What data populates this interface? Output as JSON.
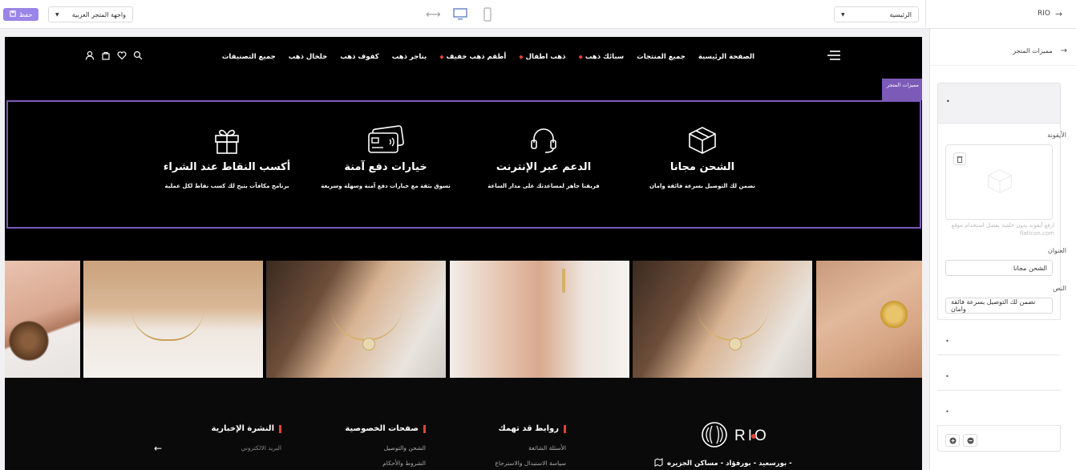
{
  "topbar": {
    "save_label": "حفظ",
    "storefront_select": "واجهة المتجر العربية",
    "page_select": "الرئيسية",
    "app_name": "RIO"
  },
  "sidebar": {
    "back_label": "مميزات المتجر",
    "icon_label": "الأيقونة",
    "icon_hint": "ارفع أيقونة بدون خلفية يفضل استخدام موقع flaticon.com",
    "title_label": "العنوان",
    "title_value": "الشحن مجانا",
    "text_label": "النص",
    "text_value": "نضمن لك التوصيل بسرعة فائقة وامان"
  },
  "store": {
    "nav": [
      "الصفحة الرئيسية",
      "جميع المنتجات",
      "سبائك ذهب",
      "ذهب اطفال",
      "أطقم ذهب خفيف",
      "بناجر ذهب",
      "كفوف ذهب",
      "خلخال ذهب",
      "جميع التصنيفات"
    ],
    "section_tag": "مميزات المتجر",
    "features": [
      {
        "icon": "box-icon",
        "title": "الشحن مجانا",
        "text": "نضمن لك التوصيل بسرعة فائقة وامان"
      },
      {
        "icon": "headset-icon",
        "title": "الدعم عبر الإنترنت",
        "text": "فريقنا جاهز لمساعدتك على مدار الساعة"
      },
      {
        "icon": "card-icon",
        "title": "خيارات دفع آمنة",
        "text": "تسوق بثقة مع خيارات دفع آمنة وسهلة وسريعة"
      },
      {
        "icon": "gift-icon",
        "title": "أكسب النقاط عند الشراء",
        "text": "برنامج مكافآت يتيح لك كسب نقاط لكل عملية"
      }
    ],
    "footer": {
      "brand": "RIO",
      "address": "بورسعيد - بورفؤاد - مساكن الجزيره -",
      "links_title": "روابط قد تهمك",
      "links": [
        "الأسئلة الشائعة",
        "سياسة الاستبدال والاسترجاع"
      ],
      "privacy_title": "صفحات الخصوصية",
      "privacy": [
        "الشحن والتوصيل",
        "الشروط والأحكام"
      ],
      "news_title": "النشرة الإخبارية",
      "news_placeholder": "البريد الالكتروني"
    }
  }
}
